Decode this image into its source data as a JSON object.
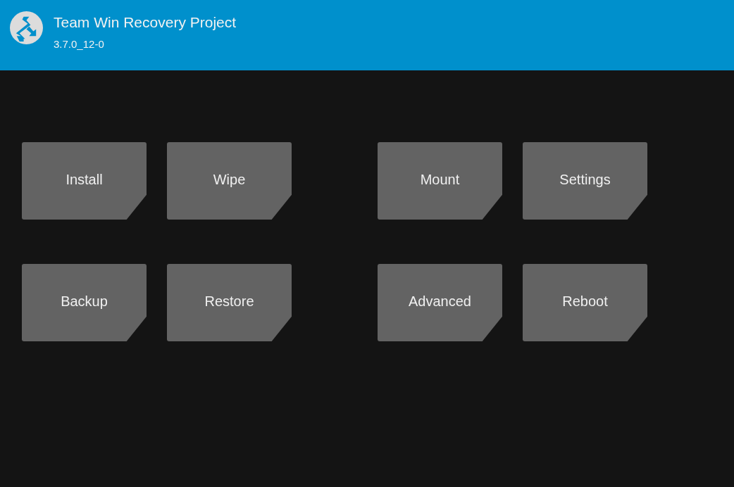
{
  "header": {
    "title": "Team Win Recovery Project",
    "version": "3.7.0_12-0"
  },
  "button_groups": [
    {
      "buttons": [
        {
          "label": "Install"
        },
        {
          "label": "Wipe"
        },
        {
          "label": "Backup"
        },
        {
          "label": "Restore"
        }
      ]
    },
    {
      "buttons": [
        {
          "label": "Mount"
        },
        {
          "label": "Settings"
        },
        {
          "label": "Advanced"
        },
        {
          "label": "Reboot"
        }
      ]
    }
  ]
}
